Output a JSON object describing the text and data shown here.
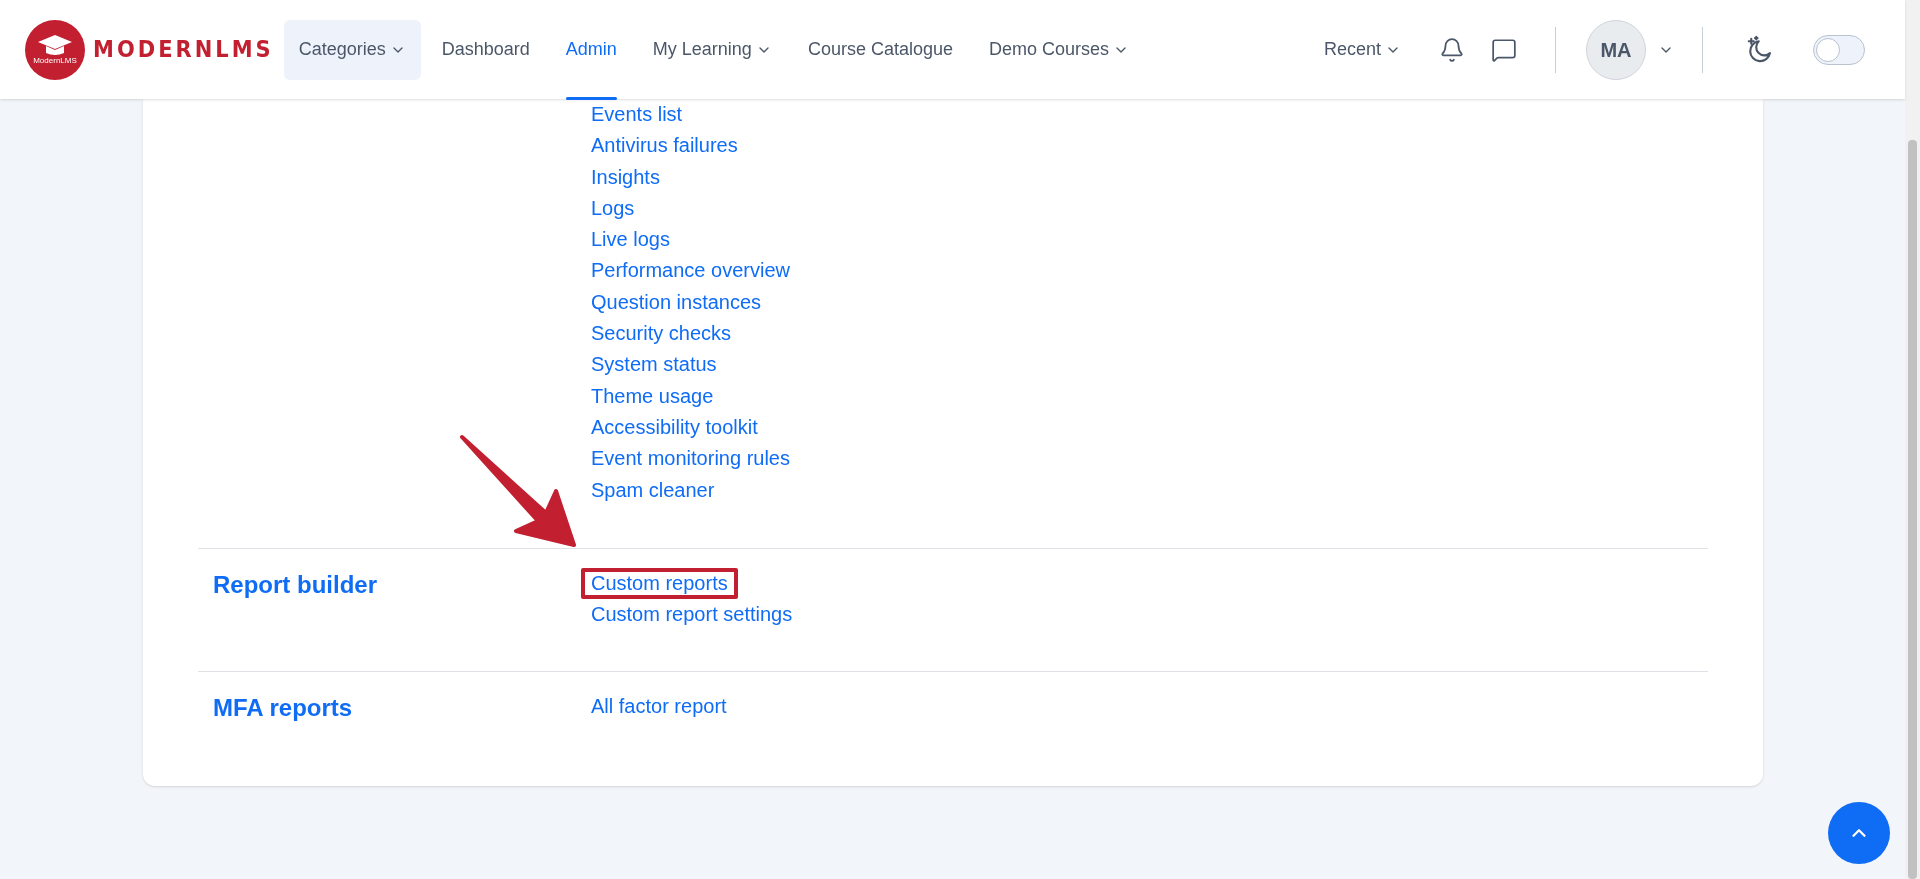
{
  "header": {
    "logo": {
      "text": "MODERNLMS",
      "caption": "ModernLMS"
    },
    "nav": [
      {
        "label": "Categories",
        "dropdown": true,
        "selected": false,
        "boxed": true
      },
      {
        "label": "Dashboard",
        "dropdown": false,
        "selected": false,
        "boxed": false
      },
      {
        "label": "Admin",
        "dropdown": false,
        "selected": true,
        "boxed": false
      },
      {
        "label": "My Learning",
        "dropdown": true,
        "selected": false,
        "boxed": false
      },
      {
        "label": "Course Catalogue",
        "dropdown": false,
        "selected": false,
        "boxed": false
      },
      {
        "label": "Demo Courses",
        "dropdown": true,
        "selected": false,
        "boxed": false
      }
    ],
    "recent": "Recent",
    "avatar": "MA",
    "dark_mode": {
      "on": false
    }
  },
  "sections": [
    {
      "links": [
        {
          "label": "Events list",
          "highlighted": false
        },
        {
          "label": "Antivirus failures",
          "highlighted": false
        },
        {
          "label": "Insights",
          "highlighted": false
        },
        {
          "label": "Logs",
          "highlighted": false
        },
        {
          "label": "Live logs",
          "highlighted": false
        },
        {
          "label": "Performance overview",
          "highlighted": false
        },
        {
          "label": "Question instances",
          "highlighted": false
        },
        {
          "label": "Security checks",
          "highlighted": false
        },
        {
          "label": "System status",
          "highlighted": false
        },
        {
          "label": "Theme usage",
          "highlighted": false
        },
        {
          "label": "Accessibility toolkit",
          "highlighted": false
        },
        {
          "label": "Event monitoring rules",
          "highlighted": false
        },
        {
          "label": "Spam cleaner",
          "highlighted": false
        }
      ]
    },
    {
      "title": "Report builder",
      "links": [
        {
          "label": "Custom reports",
          "highlighted": true
        },
        {
          "label": "Custom report settings",
          "highlighted": false
        }
      ]
    },
    {
      "title": "MFA reports",
      "links": [
        {
          "label": "All factor report",
          "highlighted": false
        }
      ]
    }
  ]
}
